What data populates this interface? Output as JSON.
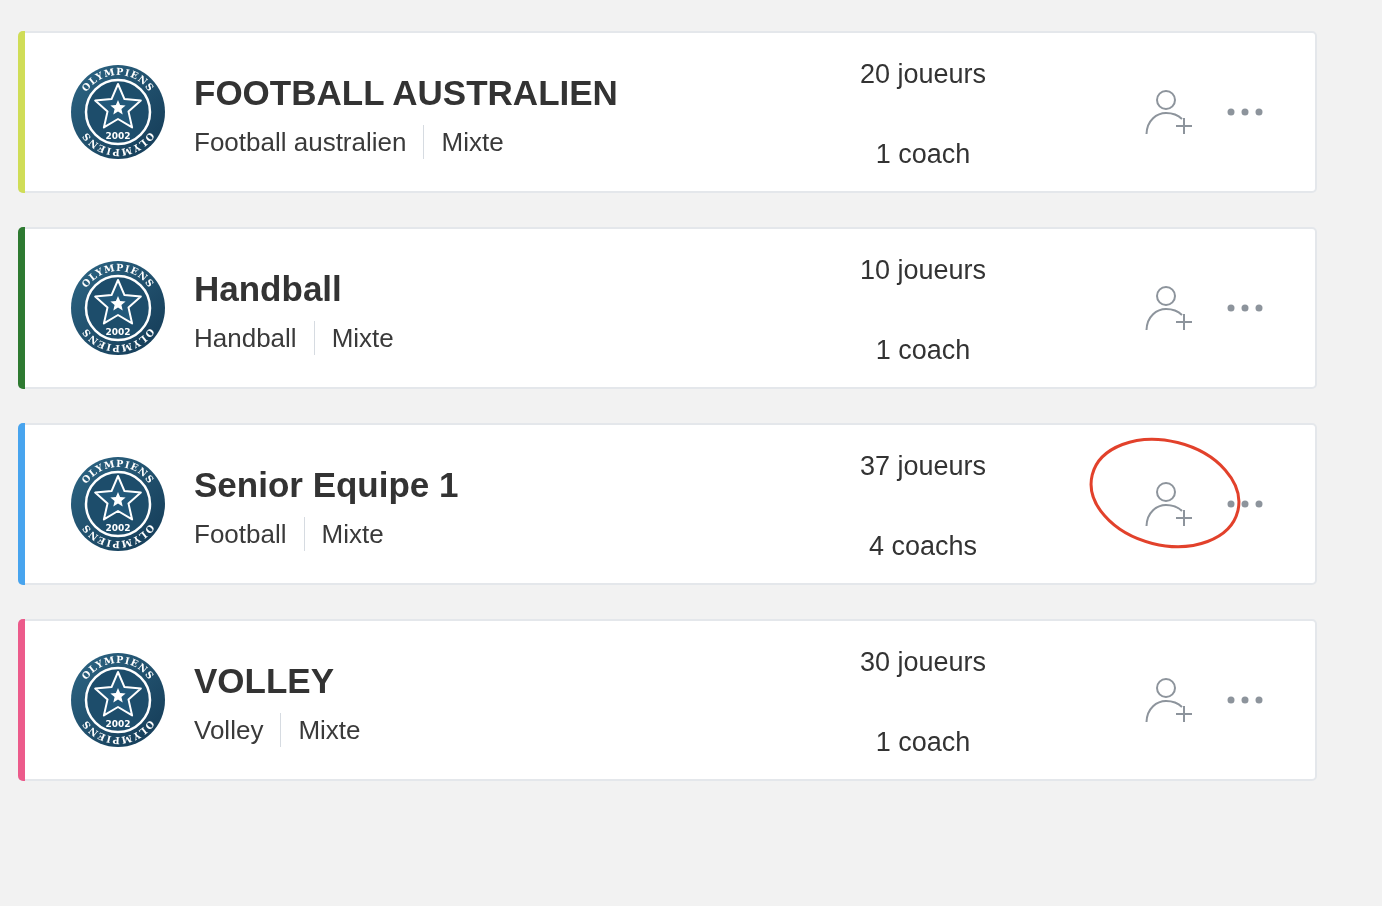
{
  "teams": [
    {
      "color": "#d0dd57",
      "logo": {
        "top_text": "OLYMPIENS",
        "year": "2002",
        "bottom_text": "OLYMPIENS"
      },
      "name": "FOOTBALL AUSTRALIEN",
      "sport": "Football australien",
      "gender": "Mixte",
      "players": "20 joueurs",
      "coaches": "1 coach",
      "highlighted": false
    },
    {
      "color": "#2e7a31",
      "logo": {
        "top_text": "OLYMPIENS",
        "year": "2002",
        "bottom_text": "OLYMPIENS"
      },
      "name": "Handball",
      "sport": "Handball",
      "gender": "Mixte",
      "players": "10 joueurs",
      "coaches": "1 coach",
      "highlighted": false
    },
    {
      "color": "#48a4ee",
      "logo": {
        "top_text": "OLYMPIENS",
        "year": "2002",
        "bottom_text": "OLYMPIENS"
      },
      "name": "Senior Equipe 1",
      "sport": "Football",
      "gender": "Mixte",
      "players": "37 joueurs",
      "coaches": "4 coachs",
      "highlighted": true
    },
    {
      "color": "#ec5b8b",
      "logo": {
        "top_text": "OLYMPIENS",
        "year": "2002",
        "bottom_text": "OLYMPIENS"
      },
      "name": "VOLLEY",
      "sport": "Volley",
      "gender": "Mixte",
      "players": "30 joueurs",
      "coaches": "1 coach",
      "highlighted": false
    }
  ]
}
